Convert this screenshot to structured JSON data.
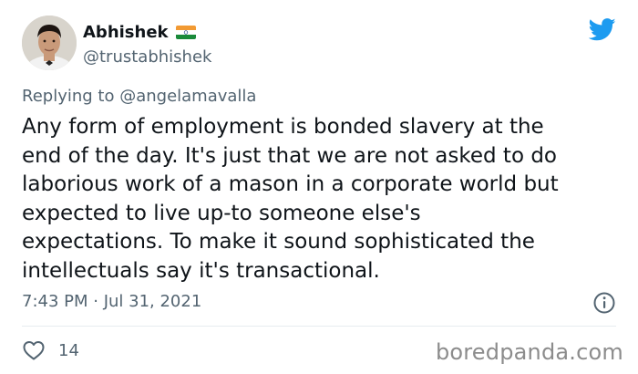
{
  "user": {
    "display_name": "Abhishek",
    "handle": "@trustabhishek"
  },
  "reply": {
    "prefix": "Replying to ",
    "mention": "@angelamavalla"
  },
  "tweet": {
    "text": "Any form of employment is bonded slavery at the\nend of the day. It's just that we are not asked to do\nlaborious work of a mason in a corporate world but\nexpected to live up-to someone else's\nexpectations. To make it sound sophisticated the\nintellectuals say it's transactional.",
    "timestamp": "7:43 PM · Jul 31, 2021",
    "like_count": "14"
  },
  "icons": {
    "flag": "india-flag-icon",
    "brand": "twitter-bird-icon",
    "info": "info-icon",
    "like": "heart-icon"
  },
  "colors": {
    "twitter_blue": "#1d9bf0",
    "secondary_text": "#536471",
    "primary_text": "#0f1419",
    "watermark": "#8c8c8c"
  },
  "watermark": "boredpanda.com"
}
